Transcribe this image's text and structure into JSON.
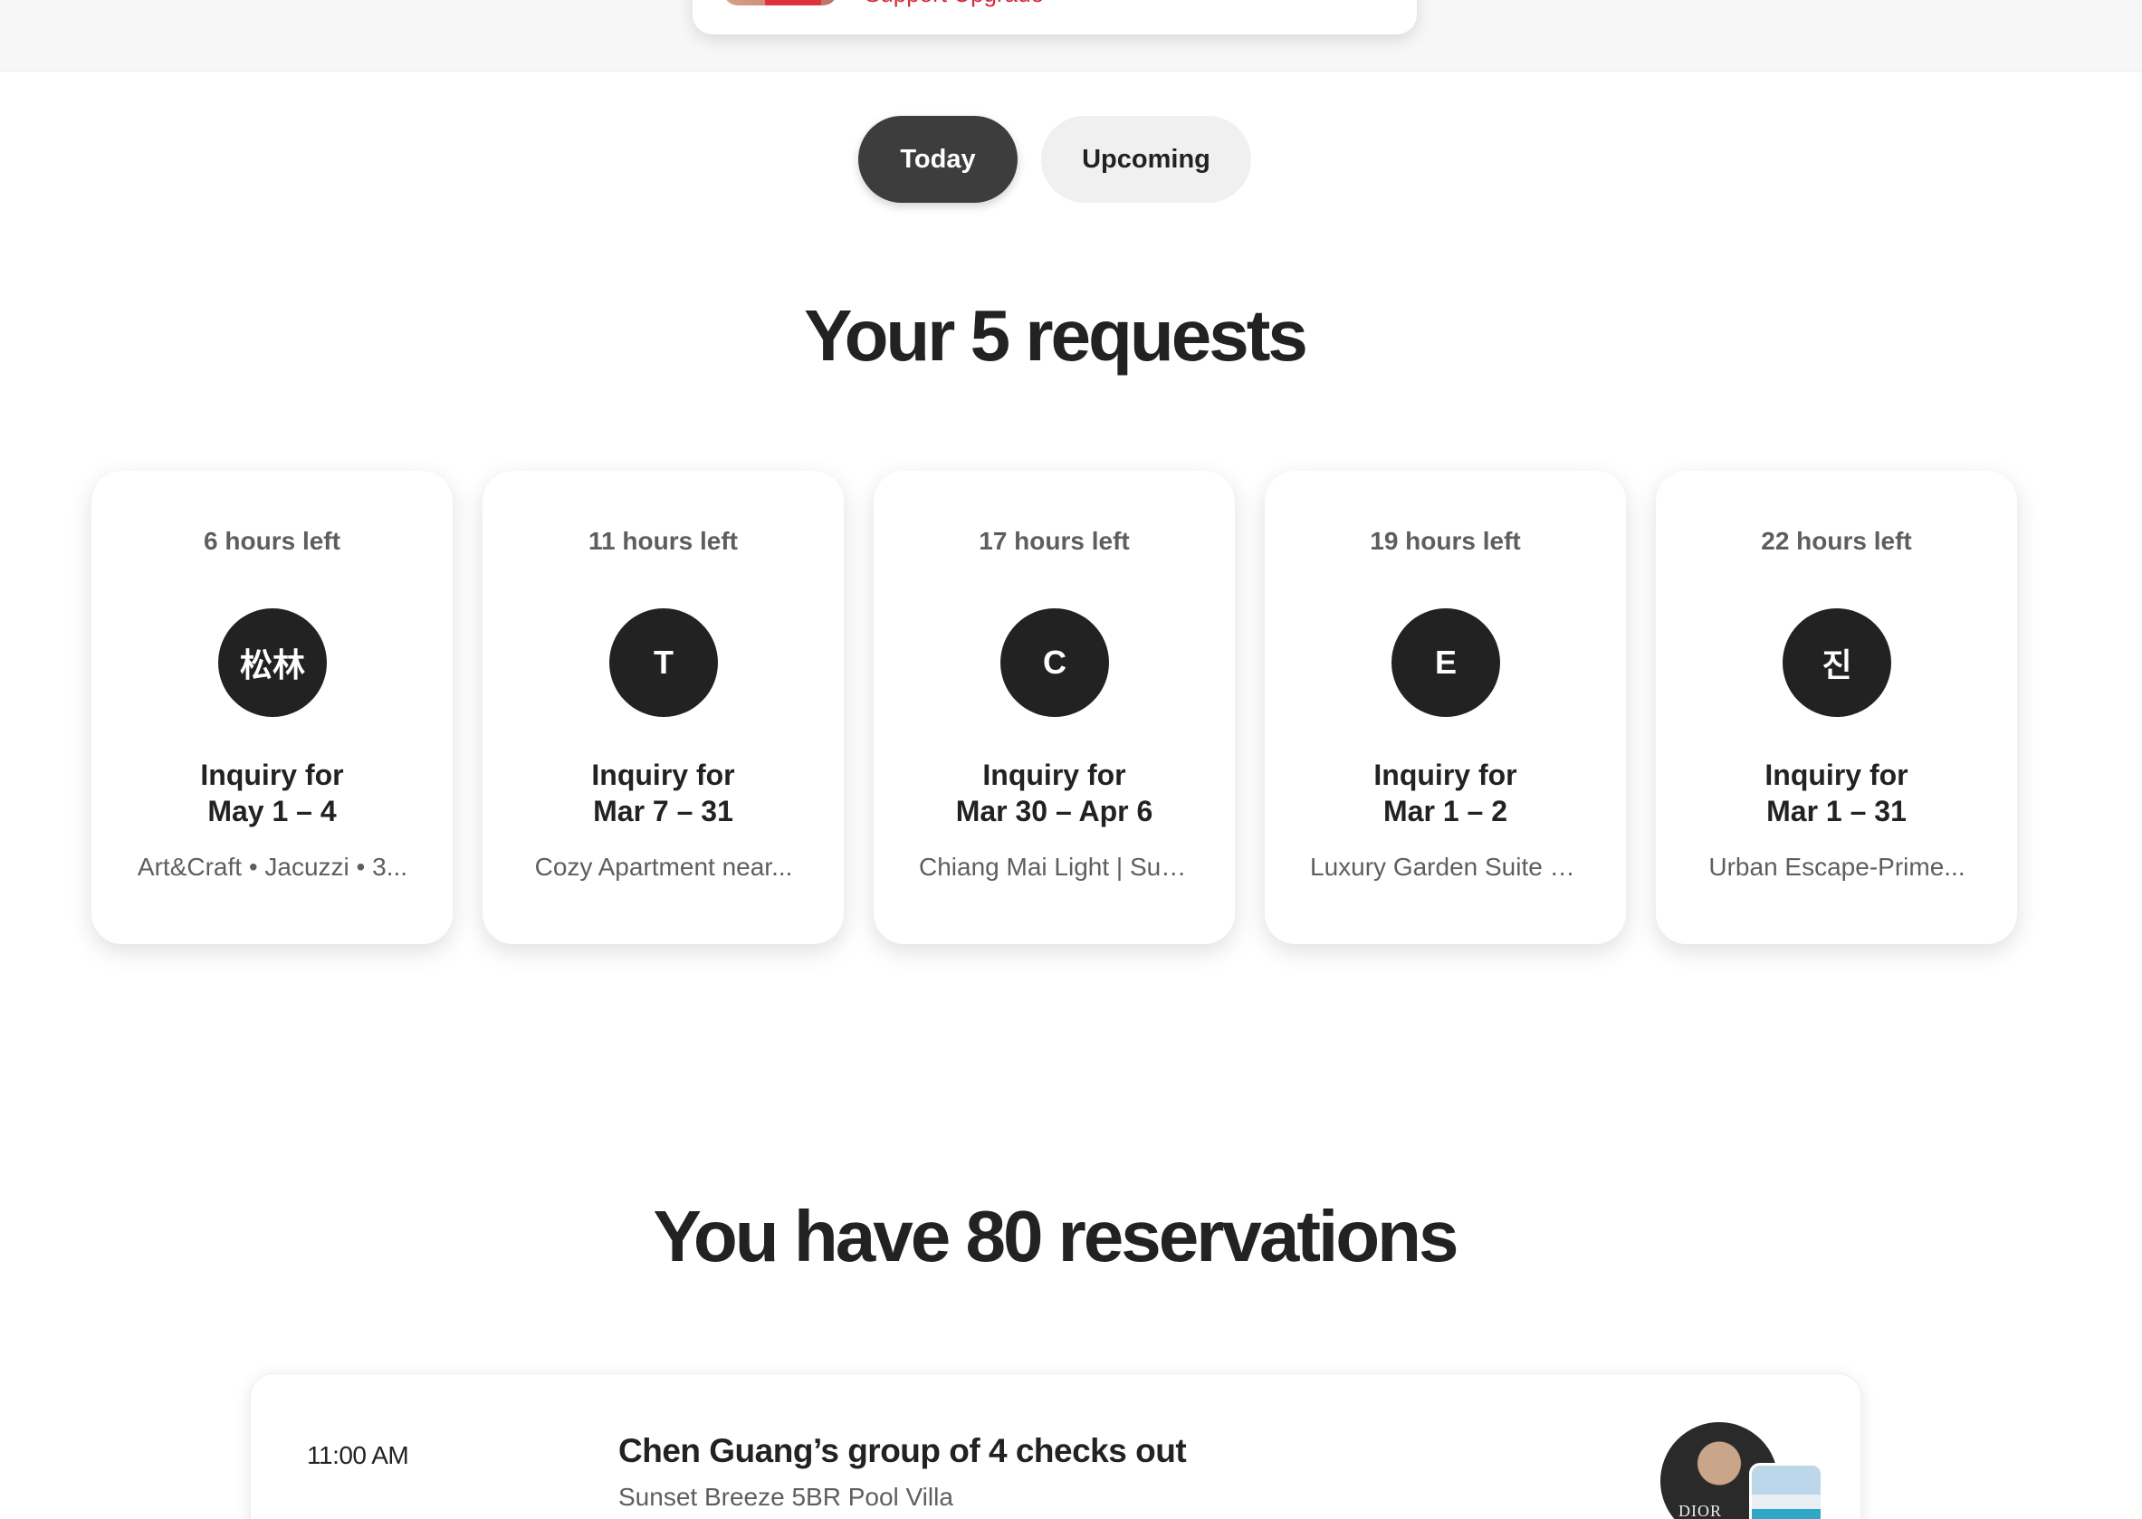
{
  "promo": {
    "text": "Support Upgrade"
  },
  "tabs": [
    {
      "label": "Today",
      "active": true
    },
    {
      "label": "Upcoming",
      "active": false
    }
  ],
  "requests": {
    "title": "Your 5 requests",
    "items": [
      {
        "time_left": "6 hours left",
        "avatar": "松林",
        "inquiry_line1": "Inquiry for",
        "inquiry_line2": "May 1 – 4",
        "listing": "Art&Craft • Jacuzzi • 3..."
      },
      {
        "time_left": "11 hours left",
        "avatar": "T",
        "inquiry_line1": "Inquiry for",
        "inquiry_line2": "Mar 7 – 31",
        "listing": "Cozy Apartment near..."
      },
      {
        "time_left": "17 hours left",
        "avatar": "C",
        "inquiry_line1": "Inquiry for",
        "inquiry_line2": "Mar 30 – Apr 6",
        "listing": "Chiang Mai Light | Suan.."
      },
      {
        "time_left": "19 hours left",
        "avatar": "E",
        "inquiry_line1": "Inquiry for",
        "inquiry_line2": "Mar 1 – 2",
        "listing": "Luxury Garden Suite at.."
      },
      {
        "time_left": "22 hours left",
        "avatar": "진",
        "inquiry_line1": "Inquiry for",
        "inquiry_line2": "Mar 1 – 31",
        "listing": "Urban Escape-Prime..."
      }
    ]
  },
  "reservations": {
    "title": "You have 80 reservations",
    "items": [
      {
        "time": "11:00 AM",
        "title": "Chen Guang’s group of 4 checks out",
        "listing": "Sunset Breeze 5BR Pool Villa",
        "shirt_text": "DIOR"
      }
    ]
  }
}
